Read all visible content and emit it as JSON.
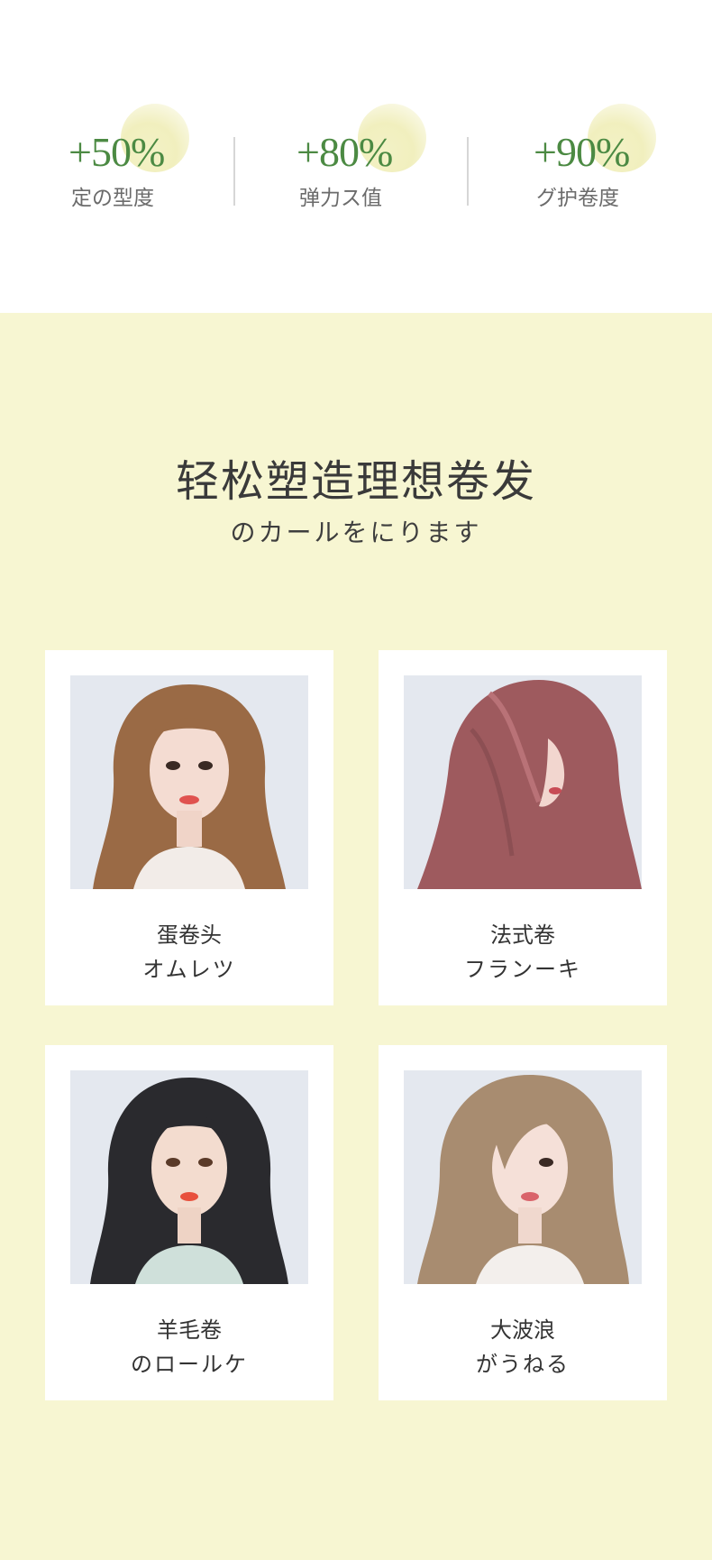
{
  "stats": [
    {
      "value": "+50%",
      "label": "定の型度"
    },
    {
      "value": "+80%",
      "label": "弹力ス值"
    },
    {
      "value": "+90%",
      "label": "グ护卷度"
    }
  ],
  "section": {
    "title": "轻松塑造理想卷发",
    "subtitle": "のカールをにります"
  },
  "styles": [
    {
      "name_cn": "蛋卷头",
      "name_jp": "オムレツ",
      "hair_color": "#9a6a45"
    },
    {
      "name_cn": "法式卷",
      "name_jp": "フランーキ",
      "hair_color": "#9e5a5e"
    },
    {
      "name_cn": "羊毛卷",
      "name_jp": "のロールケ",
      "hair_color": "#2a2a2e"
    },
    {
      "name_cn": "大波浪",
      "name_jp": "がうねる",
      "hair_color": "#a88c70"
    }
  ],
  "colors": {
    "accent_green": "#4c8a43",
    "section_bg": "#f7f6d2"
  }
}
